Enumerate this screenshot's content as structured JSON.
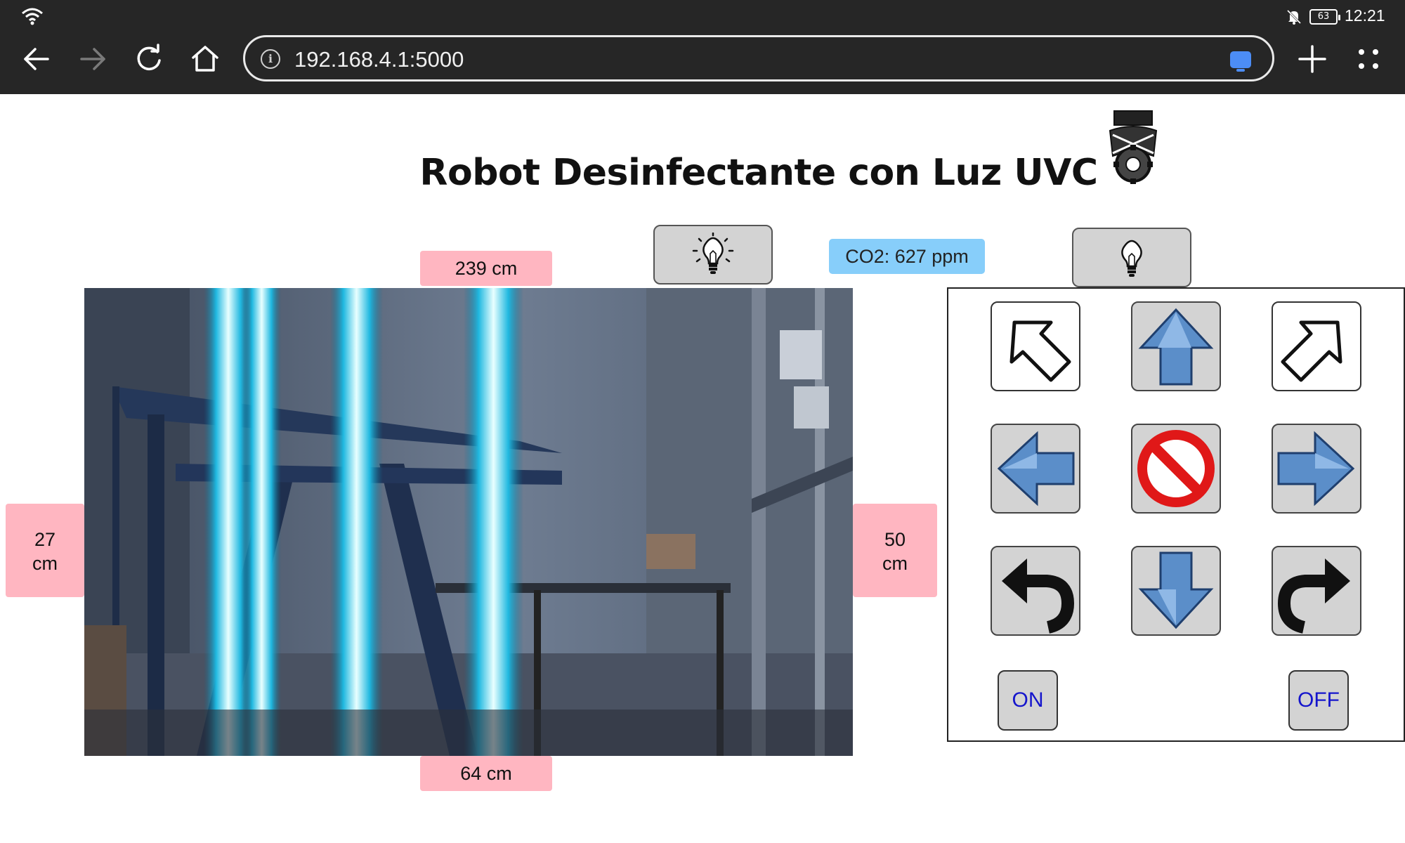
{
  "status_bar": {
    "time": "12:21",
    "battery_level": "63",
    "icons": [
      "wifi-icon",
      "bell-off-icon",
      "battery-icon"
    ]
  },
  "browser": {
    "url": "192.168.4.1:5000",
    "icons": [
      "back-arrow-icon",
      "forward-arrow-icon",
      "reload-icon",
      "home-icon",
      "info-icon",
      "cast-icon",
      "plus-icon",
      "menu-dots-icon"
    ]
  },
  "page": {
    "title": "Robot Desinfectante con Luz UVC",
    "co2_label": "CO2: 627 ppm",
    "distances": {
      "front": "239 cm",
      "back": "64 cm",
      "left_value": "27",
      "left_unit": "cm",
      "right_value": "50",
      "right_unit": "cm"
    },
    "lamp_buttons": [
      {
        "name": "uv-lamp-on-button",
        "icon": "lightbulb-on-icon"
      },
      {
        "name": "uv-lamp-off-button",
        "icon": "lightbulb-off-icon"
      }
    ],
    "controls": {
      "directions": [
        "forward-left",
        "forward",
        "forward-right",
        "left",
        "stop",
        "right",
        "rotate-left",
        "backward",
        "rotate-right"
      ],
      "on_label": "ON",
      "off_label": "OFF"
    },
    "colors": {
      "distance_badge": "#ffb6c1",
      "co2_badge": "#87cefa",
      "button_gray": "#d3d3d3",
      "power_text": "#1515cc",
      "stop_red": "#e01818",
      "arrow_blue": "#5b8ec9"
    }
  }
}
